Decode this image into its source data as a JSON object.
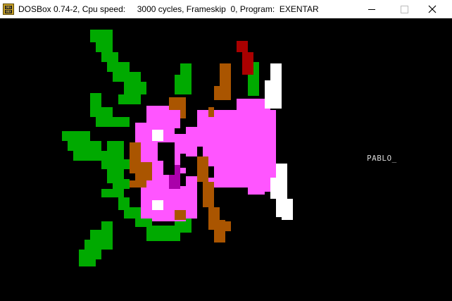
{
  "window": {
    "title": "DOSBox 0.74-2, Cpu speed:     3000 cycles, Frameskip  0, Program:  EXENTAR",
    "icon": "dosbox-icon",
    "icon_text_top": "DOS",
    "icon_text_bottom": "BOX",
    "controls": [
      "minimize-icon",
      "maximize-icon",
      "close-icon"
    ]
  },
  "screen": {
    "background": "#000000",
    "prompt_text": "PABLO",
    "cursor": "_",
    "palette": {
      "green": "#00aa00",
      "pink": "#ff55ff",
      "brown": "#aa5500",
      "white": "#ffffff",
      "red": "#aa0000",
      "magenta": "#aa00aa",
      "prompt": "#d8d8d8"
    }
  }
}
